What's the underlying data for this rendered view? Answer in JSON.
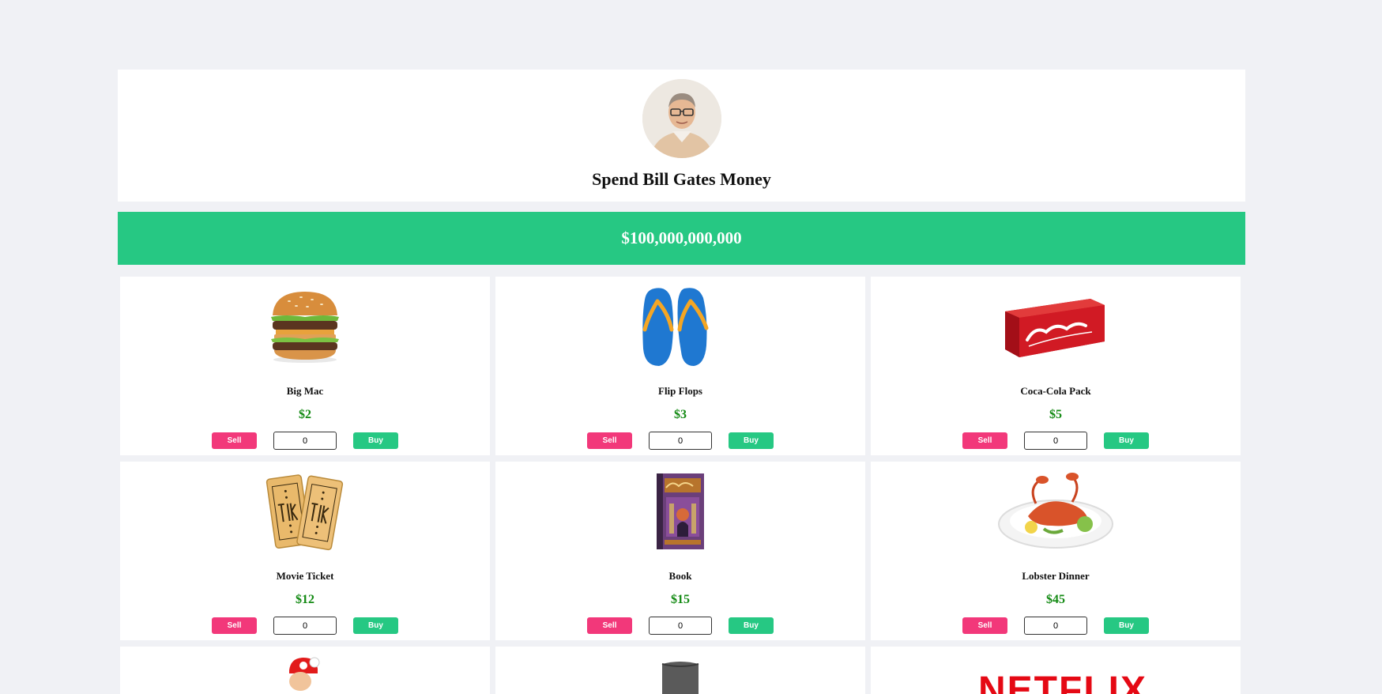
{
  "header": {
    "title": "Spend Bill Gates Money",
    "avatar_icon": "portrait-photo"
  },
  "balance": {
    "amount": "$100,000,000,000",
    "color": "#26c883"
  },
  "controls": {
    "sell_label": "Sell",
    "buy_label": "Buy",
    "sell_color": "#f2387a",
    "buy_color": "#26c883"
  },
  "products": [
    {
      "name": "Big Mac",
      "price": "$2",
      "quantity": "0",
      "image_icon": "burger-image"
    },
    {
      "name": "Flip Flops",
      "price": "$3",
      "quantity": "0",
      "image_icon": "flip-flops-image"
    },
    {
      "name": "Coca-Cola Pack",
      "price": "$5",
      "quantity": "0",
      "image_icon": "soda-pack-image"
    },
    {
      "name": "Movie Ticket",
      "price": "$12",
      "quantity": "0",
      "image_icon": "tickets-image"
    },
    {
      "name": "Book",
      "price": "$15",
      "quantity": "0",
      "image_icon": "book-image"
    },
    {
      "name": "Lobster Dinner",
      "price": "$45",
      "quantity": "0",
      "image_icon": "lobster-plate-image"
    }
  ],
  "partial_row": {
    "third_logo_text": "NETFLIX"
  }
}
